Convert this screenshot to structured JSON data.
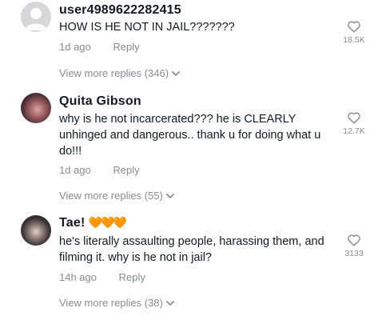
{
  "comments": [
    {
      "username": "user4989622282415",
      "badges": "",
      "text": "HOW IS HE NOT IN JAIL???????",
      "time": "1d ago",
      "reply_label": "Reply",
      "likes": "18.5K",
      "view_replies": "View more replies (346)"
    },
    {
      "username": "Quita Gibson",
      "badges": "",
      "text": "why is he not incarcerated??? he is CLEARLY unhinged and dangerous.. thank u for doing what u do!!!",
      "time": "1d ago",
      "reply_label": "Reply",
      "likes": "12.7K",
      "view_replies": "View more replies (55)"
    },
    {
      "username": "Tae!",
      "badges": "🧡🧡🧡",
      "text": "he's literally assaulting people, harassing them, and filming it. why is he not in jail?",
      "time": "14h ago",
      "reply_label": "Reply",
      "likes": "3133",
      "view_replies": "View more replies (38)"
    }
  ],
  "colors": {
    "text": "#161823",
    "muted": "#8a8b91",
    "badge": "#ff8a00"
  },
  "icons": {
    "like": "heart-outline-icon",
    "expand": "chevron-down-icon"
  }
}
